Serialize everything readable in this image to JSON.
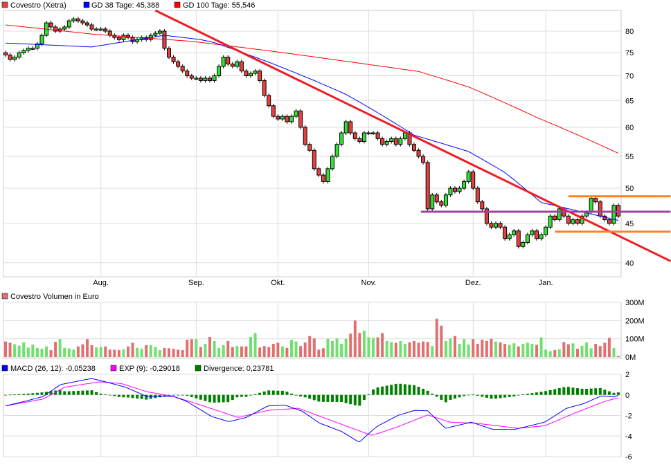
{
  "chart_data": [
    {
      "type": "candlestick",
      "title": "Covestro (Xetra)",
      "legend": [
        {
          "label": "Covestro (Xetra)",
          "color": "#e84040"
        },
        {
          "label": "GD 38 Tage: 45,388",
          "color": "#0000ff"
        },
        {
          "label": "GD 100 Tage: 55,546",
          "color": "#ff0000"
        }
      ],
      "y_scale": "log",
      "ylim": [
        38.5,
        86
      ],
      "y_ticks": [
        "40",
        "45",
        "50",
        "55",
        "60",
        "65",
        "70",
        "75",
        "80"
      ],
      "y_tick_values": [
        40,
        45,
        50,
        55,
        60,
        65,
        70,
        75,
        80
      ],
      "x_ticks": [
        {
          "label": "Aug.",
          "day": 21
        },
        {
          "label": "Sep.",
          "day": 42
        },
        {
          "label": "Okt.",
          "day": 60
        },
        {
          "label": "Nov.",
          "day": 80
        },
        {
          "label": "Dez.",
          "day": 103
        },
        {
          "label": "Jan.",
          "day": 119
        }
      ],
      "closes": [
        74.5,
        73.5,
        74,
        75,
        75.5,
        76,
        76,
        77,
        79,
        82,
        81,
        80,
        80.5,
        81,
        82.5,
        83,
        82.5,
        82,
        81.5,
        80.5,
        80.5,
        80.5,
        80,
        79,
        78.5,
        78,
        79,
        78.5,
        77.5,
        78,
        78.5,
        78,
        79,
        79.5,
        80,
        76,
        74,
        73,
        72,
        71,
        70,
        69.5,
        69.5,
        69,
        69.5,
        69,
        70,
        72,
        74,
        72.5,
        72,
        73,
        71,
        70,
        70.5,
        71,
        69,
        66,
        64,
        62,
        61.5,
        62,
        61,
        62,
        63,
        60,
        57,
        56,
        53,
        52,
        51,
        53,
        55,
        57,
        59,
        61,
        59,
        58,
        57.5,
        59,
        59,
        59,
        58,
        57,
        57.5,
        58,
        57,
        58,
        59,
        57,
        56,
        55,
        54,
        47,
        49,
        48,
        47.5,
        49,
        50,
        49.5,
        50,
        51,
        52.5,
        50,
        48,
        47,
        45,
        44.5,
        45,
        44.5,
        43,
        43.5,
        44,
        42,
        42.5,
        43.5,
        44,
        43,
        43.5,
        44.5,
        46,
        45.5,
        47,
        46,
        45,
        45.5,
        45,
        46,
        46.5,
        48.5,
        48,
        46,
        45.5,
        45,
        47.5,
        46
      ],
      "gd38": [
        [
          0,
          77.2
        ],
        [
          19,
          76.3
        ],
        [
          35,
          79
        ],
        [
          43,
          78
        ],
        [
          46,
          77.3
        ],
        [
          58,
          72.9
        ],
        [
          68,
          69
        ],
        [
          75,
          66.2
        ],
        [
          90,
          58.6
        ],
        [
          102,
          55.8
        ],
        [
          110,
          52.4
        ],
        [
          118,
          47.9
        ],
        [
          135,
          45.4
        ]
      ],
      "gd100": [
        [
          0,
          81.5
        ],
        [
          20,
          79.2
        ],
        [
          41,
          77.6
        ],
        [
          59,
          75.3
        ],
        [
          80,
          72.4
        ],
        [
          91,
          70.9
        ],
        [
          102,
          67.7
        ],
        [
          117,
          61.8
        ],
        [
          135,
          55.5
        ]
      ],
      "trendlines": [
        {
          "name": "downtrend",
          "color": "#ee1c24",
          "from": [
            33,
            85.1
          ],
          "to": [
            146.5,
            40.2
          ]
        },
        {
          "name": "resistance-purple",
          "color": "#a040a0",
          "from": [
            91.5,
            46.6
          ],
          "to": [
            146.5,
            46.6
          ]
        },
        {
          "name": "upper-orange",
          "color": "#ff8020",
          "from": [
            124,
            48.8
          ],
          "to": [
            146.5,
            48.8
          ]
        },
        {
          "name": "lower-orange",
          "color": "#ff8020",
          "from": [
            121,
            43.9
          ],
          "to": [
            146.5,
            43.9
          ]
        }
      ]
    },
    {
      "type": "bar",
      "title": "Covestro Volumen in Euro",
      "legend_color": "#e07070",
      "up_color": "#70e070",
      "down_color": "#e07070",
      "ylim": [
        0,
        300
      ],
      "y_ticks": [
        "0M",
        "100M",
        "200M",
        "300M"
      ],
      "y_tick_values": [
        0,
        100,
        200,
        300
      ],
      "values_millions": [
        85,
        78,
        70,
        62,
        80,
        52,
        68,
        50,
        45,
        58,
        38,
        83,
        98,
        50,
        47,
        40,
        58,
        70,
        98,
        65,
        52,
        55,
        58,
        40,
        40,
        38,
        42,
        58,
        78,
        50,
        45,
        65,
        65,
        55,
        38,
        50,
        48,
        45,
        40,
        38,
        95,
        98,
        98,
        55,
        72,
        110,
        88,
        50,
        65,
        88,
        55,
        60,
        58,
        58,
        110,
        132,
        52,
        60,
        55,
        72,
        78,
        58,
        50,
        95,
        85,
        60,
        80,
        115,
        102,
        40,
        48,
        100,
        88,
        102,
        72,
        100,
        128,
        200,
        132,
        145,
        108,
        105,
        108,
        132,
        88,
        82,
        78,
        88,
        72,
        80,
        88,
        78,
        85,
        83,
        60,
        210,
        172,
        88,
        102,
        115,
        72,
        98,
        68,
        98,
        72,
        95,
        88,
        100,
        85,
        80,
        72,
        67,
        75,
        58,
        72,
        78,
        72,
        67,
        108,
        40,
        32,
        38,
        42,
        82,
        70,
        75,
        45,
        62,
        80,
        48,
        72,
        60,
        78,
        105,
        50,
        5
      ]
    },
    {
      "type": "line",
      "title": "MACD",
      "legend": [
        {
          "label": "MACD (26, 12): -0,05238",
          "color": "#0000ff"
        },
        {
          "label": "EXP (9): -0,29018",
          "color": "#ff00ff"
        },
        {
          "label": "Divergence: 0,23781",
          "color": "#008000"
        }
      ],
      "ylim": [
        -6,
        2
      ],
      "y_ticks": [
        "-6",
        "-4",
        "-2",
        "0",
        "2"
      ],
      "y_tick_values": [
        -6,
        -4,
        -2,
        0,
        2
      ],
      "macd": [
        [
          0,
          -1.07
        ],
        [
          4.5,
          -0.6
        ],
        [
          8.3,
          -0.15
        ],
        [
          12.1,
          1.0
        ],
        [
          19,
          1.6
        ],
        [
          22.6,
          1.2
        ],
        [
          26.4,
          0.75
        ],
        [
          31.1,
          -0.15
        ],
        [
          37,
          -0.15
        ],
        [
          39.8,
          -0.6
        ],
        [
          45.4,
          -2.1
        ],
        [
          49.2,
          -2.6
        ],
        [
          53,
          -2.2
        ],
        [
          57.8,
          -1.07
        ],
        [
          61.6,
          -1.0
        ],
        [
          65.4,
          -1.6
        ],
        [
          69.2,
          -2.75
        ],
        [
          74,
          -3.55
        ],
        [
          77.9,
          -4.6
        ],
        [
          81.7,
          -3.1
        ],
        [
          86.4,
          -2.0
        ],
        [
          90.2,
          -1.5
        ],
        [
          93,
          -1.55
        ],
        [
          96.9,
          -3.25
        ],
        [
          102.6,
          -2.65
        ],
        [
          107.3,
          -3.35
        ],
        [
          112.2,
          -3.35
        ],
        [
          118.8,
          -2.65
        ],
        [
          123.6,
          -1.3
        ],
        [
          127.4,
          -0.85
        ],
        [
          131.2,
          -0.1
        ],
        [
          134,
          -0.2
        ],
        [
          135,
          -0.05
        ]
      ],
      "exp": [
        [
          0,
          -1.07
        ],
        [
          8.3,
          -0.4
        ],
        [
          13.1,
          0.75
        ],
        [
          20.7,
          1.27
        ],
        [
          25.5,
          1.1
        ],
        [
          31.2,
          0.3
        ],
        [
          37,
          -0.15
        ],
        [
          43.6,
          -1.07
        ],
        [
          51.2,
          -2.2
        ],
        [
          57.9,
          -1.5
        ],
        [
          64.5,
          -1.3
        ],
        [
          71.2,
          -2.4
        ],
        [
          80.7,
          -3.95
        ],
        [
          86.4,
          -3.1
        ],
        [
          93,
          -1.95
        ],
        [
          97.9,
          -2.65
        ],
        [
          103.6,
          -2.75
        ],
        [
          113,
          -3.25
        ],
        [
          118.8,
          -3.0
        ],
        [
          125.5,
          -1.75
        ],
        [
          132.2,
          -0.6
        ],
        [
          135,
          -0.29
        ]
      ]
    }
  ]
}
